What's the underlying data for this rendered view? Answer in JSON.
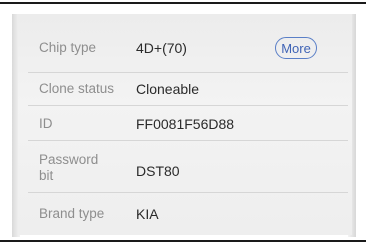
{
  "rows": [
    {
      "label": "Chip type",
      "value": "4D+(70)"
    },
    {
      "label": "Clone status",
      "value": "Cloneable"
    },
    {
      "label": "ID",
      "value": "FF0081F56D88"
    },
    {
      "label": "Password bit",
      "label_lines": [
        "Password",
        "bit"
      ],
      "value": "DST80"
    },
    {
      "label": "Brand type",
      "value": "KIA"
    }
  ],
  "more_button": {
    "label": "More"
  },
  "colors": {
    "label": "#8e8e8e",
    "value": "#2a2a2a",
    "button_accent": "#3f63b5",
    "panel_background": "#eeeeee"
  }
}
